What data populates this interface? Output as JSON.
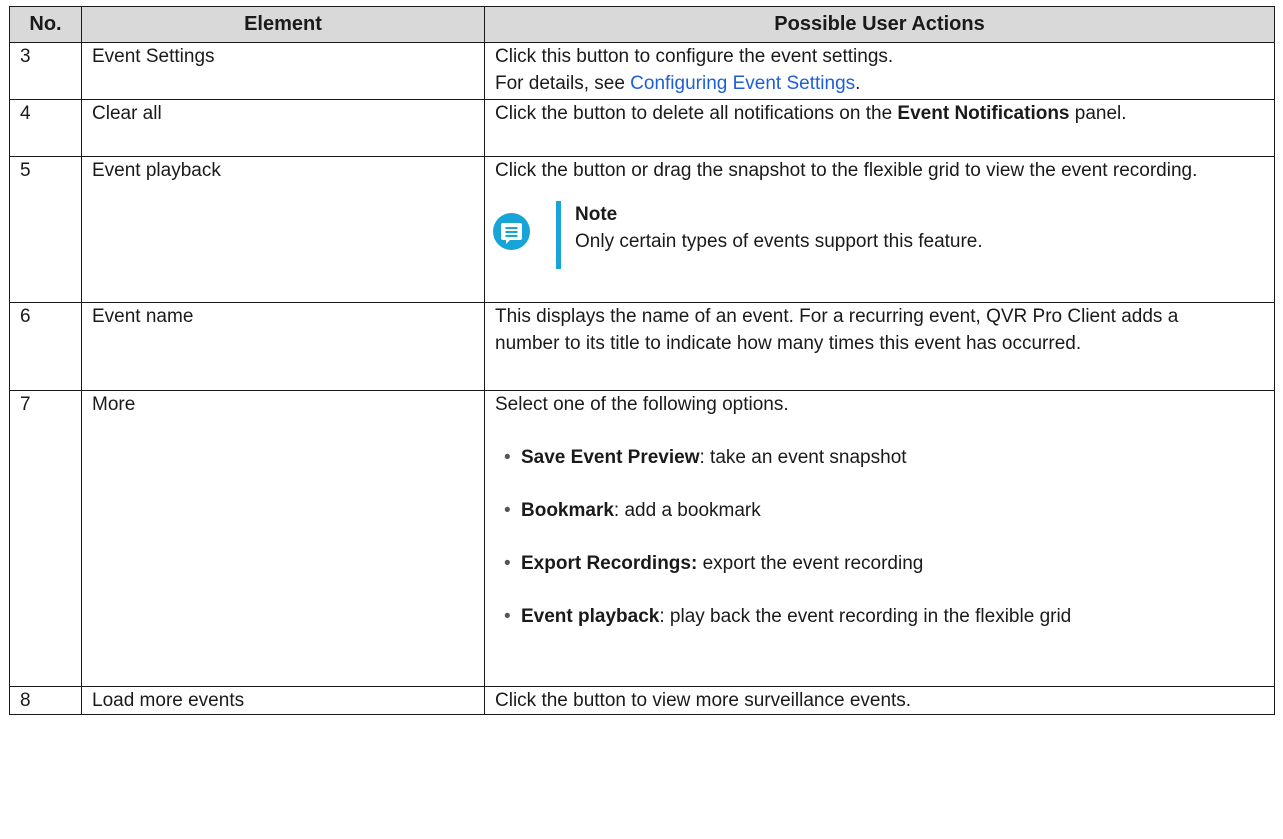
{
  "table": {
    "headers": {
      "no": "No.",
      "element": "Element",
      "actions": "Possible User Actions"
    },
    "rows": [
      {
        "no": "3",
        "element": "Event Settings",
        "line1": "Click this button to configure the event settings.",
        "line2_prefix": "For details, see ",
        "line2_link": "Configuring Event Settings",
        "line2_suffix": "."
      },
      {
        "no": "4",
        "element": "Clear all",
        "text_before": "Click the button to delete all notifications on the ",
        "bold": "Event Notifications",
        "text_after": " panel."
      },
      {
        "no": "5",
        "element": "Event playback",
        "text": "Click the button or drag the snapshot to the flexible grid to view the event recording.",
        "note_title": "Note",
        "note_text": "Only certain types of events support this feature."
      },
      {
        "no": "6",
        "element": "Event name",
        "text": "This displays the name of an event. For a recurring event, QVR Pro Client adds a number to its title to indicate how many times this event has occurred."
      },
      {
        "no": "7",
        "element": "More",
        "intro": "Select one of the following options.",
        "options": [
          {
            "bold": "Save Event Preview",
            "rest": ": take an event snapshot"
          },
          {
            "bold": "Bookmark",
            "rest": ": add a bookmark"
          },
          {
            "bold": "Export Recordings:",
            "rest": " export the event recording"
          },
          {
            "bold": "Event playback",
            "rest": ": play back the event recording in the flexible grid"
          }
        ]
      },
      {
        "no": "8",
        "element": "Load more events",
        "text": "Click the button to view more surveillance events."
      }
    ]
  },
  "colors": {
    "header_bg": "#d9d9d9",
    "link": "#1f5fd6",
    "note_accent": "#19a4d8"
  },
  "icons": {
    "note": "note-chat-icon"
  }
}
